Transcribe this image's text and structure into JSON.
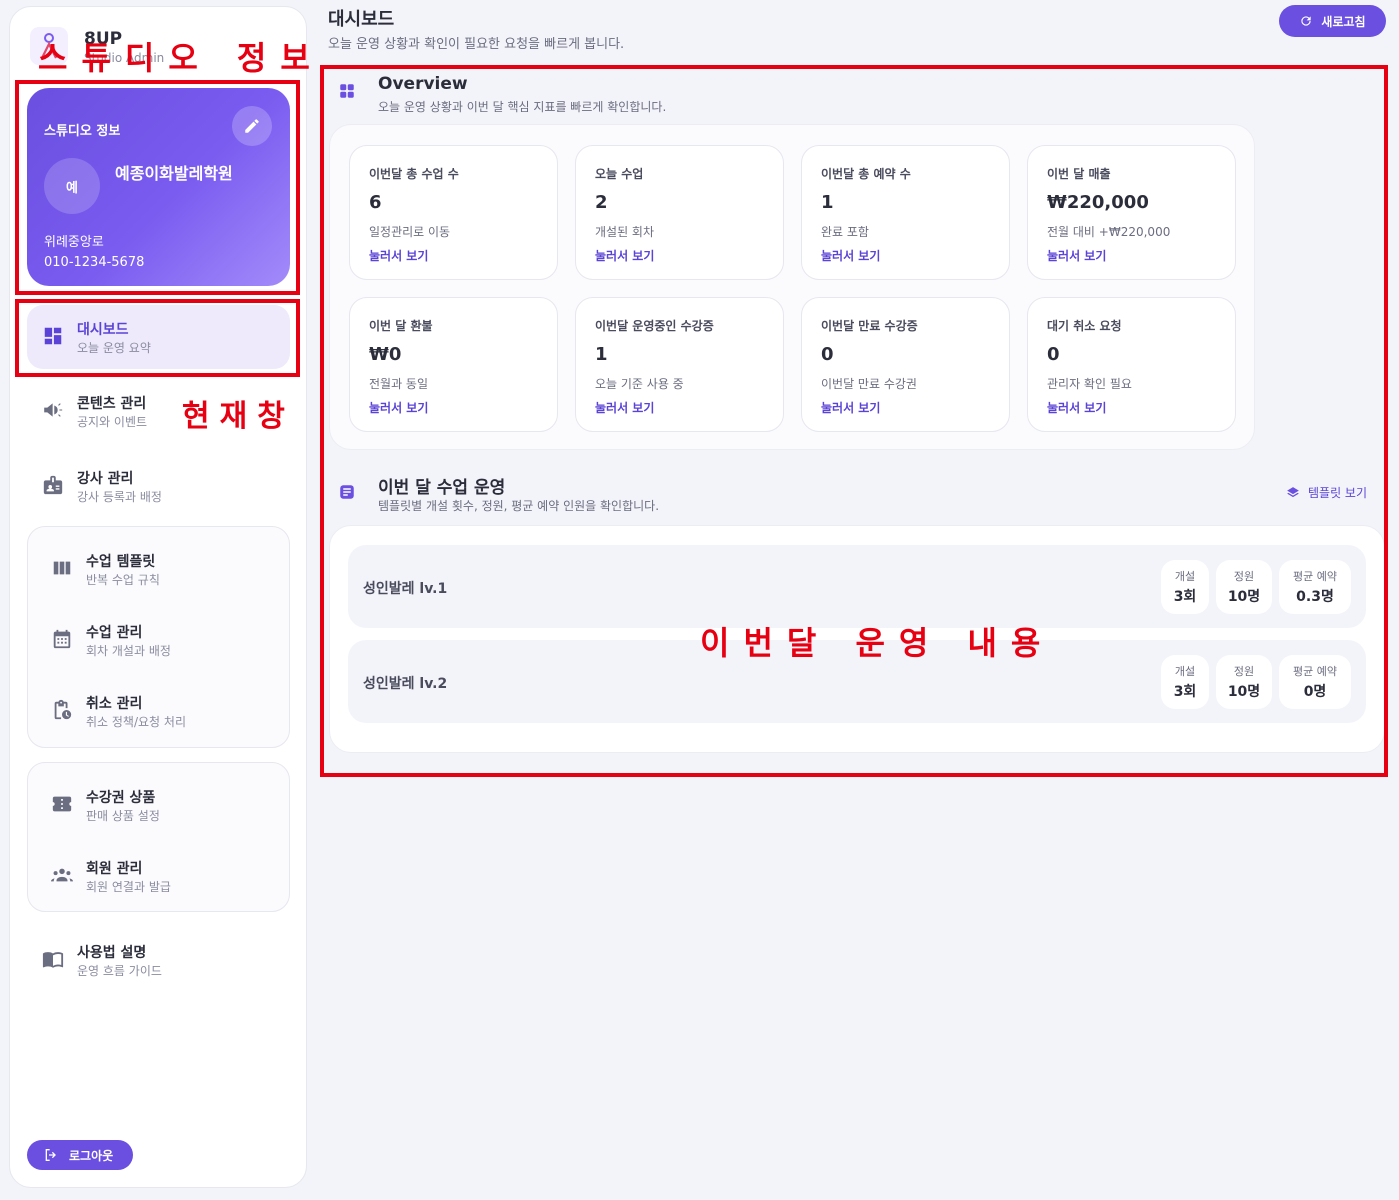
{
  "brand": {
    "name": "8UP",
    "sub": "Studio Admin"
  },
  "studio_card": {
    "label": "스튜디오 정보",
    "avatar": "예",
    "name": "예종이화발레학원",
    "address": "위례중앙로",
    "phone": "010-1234-5678"
  },
  "nav": {
    "dashboard": {
      "title": "대시보드",
      "sub": "오늘 운영 요약"
    },
    "content": {
      "title": "콘텐츠 관리",
      "sub": "공지와 이벤트"
    },
    "instructor": {
      "title": "강사 관리",
      "sub": "강사 등록과 배정"
    },
    "template": {
      "title": "수업 템플릿",
      "sub": "반복 수업 규칙"
    },
    "lesson": {
      "title": "수업 관리",
      "sub": "회차 개설과 배정"
    },
    "cancel": {
      "title": "취소 관리",
      "sub": "취소 정책/요청 처리"
    },
    "pass": {
      "title": "수강권 상품",
      "sub": "판매 상품 설정"
    },
    "member": {
      "title": "회원 관리",
      "sub": "회원 연결과 발급"
    },
    "guide": {
      "title": "사용법 설명",
      "sub": "운영 흐름 가이드"
    }
  },
  "logout_label": "로그아웃",
  "header": {
    "title": "대시보드",
    "subtitle": "오늘 운영 상황과 확인이 필요한 요청을 빠르게 봅니다.",
    "refresh_label": "새로고침"
  },
  "overview": {
    "title": "Overview",
    "subtitle": "오늘 운영 상황과 이번 달 핵심 지표를 빠르게 확인합니다.",
    "cards": [
      {
        "label": "이번달 총 수업 수",
        "value": "6",
        "desc": "일정관리로 이동",
        "link": "눌러서 보기"
      },
      {
        "label": "오늘 수업",
        "value": "2",
        "desc": "개설된 회차",
        "link": "눌러서 보기"
      },
      {
        "label": "이번달 총 예약 수",
        "value": "1",
        "desc": "완료 포함",
        "link": "눌러서 보기"
      },
      {
        "label": "이번 달 매출",
        "value": "₩220,000",
        "desc": "전월 대비 +₩220,000",
        "link": "눌러서 보기"
      },
      {
        "label": "이번 달 환불",
        "value": "₩0",
        "desc": "전월과 동일",
        "link": "눌러서 보기"
      },
      {
        "label": "이번달 운영중인 수강증",
        "value": "1",
        "desc": "오늘 기준 사용 중",
        "link": "눌러서 보기"
      },
      {
        "label": "이번달 만료 수강증",
        "value": "0",
        "desc": "이번달 만료 수강권",
        "link": "눌러서 보기"
      },
      {
        "label": "대기 취소 요청",
        "value": "0",
        "desc": "관리자 확인 필요",
        "link": "눌러서 보기"
      }
    ]
  },
  "operations": {
    "title": "이번 달 수업 운영",
    "subtitle": "템플릿별 개설 횟수, 정원, 평균 예약 인원을 확인합니다.",
    "template_link": "템플릿 보기",
    "stat_labels": {
      "opened": "개설",
      "capacity": "정원",
      "avg": "평균 예약"
    },
    "rows": [
      {
        "name": "성인발레 lv.1",
        "opened": "3회",
        "capacity": "10명",
        "avg": "0.3명"
      },
      {
        "name": "성인발레 lv.2",
        "opened": "3회",
        "capacity": "10명",
        "avg": "0명"
      }
    ]
  },
  "annotations": {
    "studio_info": "스튜디오 정보",
    "current_window": "현재창",
    "monthly_ops": "이번달 운영 내용"
  },
  "colors": {
    "accent": "#6a4fe0",
    "annotation": "#e60012"
  }
}
